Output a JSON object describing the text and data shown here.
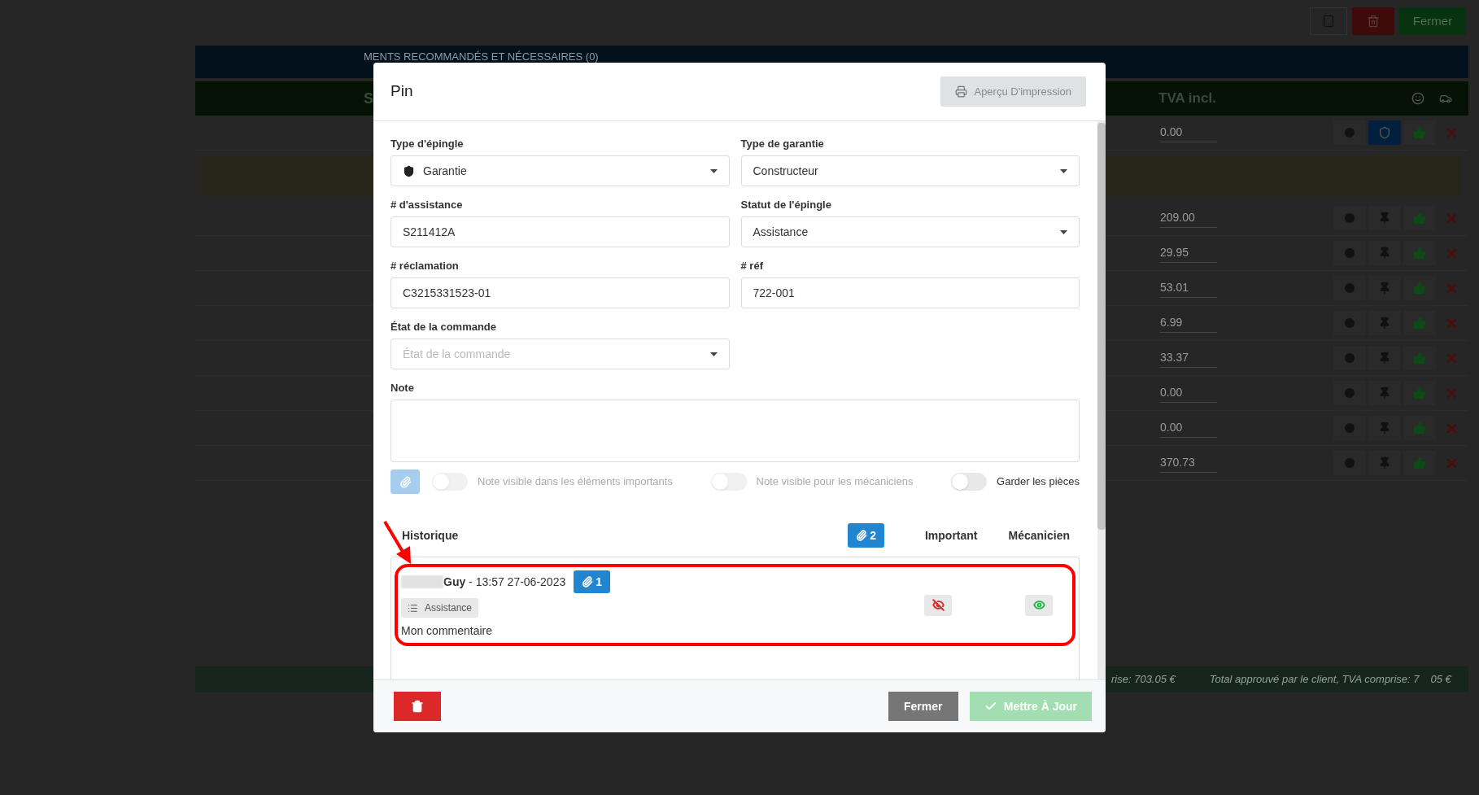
{
  "topbar": {
    "close_button": "Fermer"
  },
  "background": {
    "banner": "MENTS RECOMMANDÉS ET NÉCESSAIRES (0)",
    "header_letter": "S",
    "column_header": "TVA incl.",
    "rows": [
      {
        "amount": "0.00",
        "kind": "shield"
      },
      {
        "amount": "209.00",
        "kind": "pin"
      },
      {
        "amount": "29.95",
        "kind": "pin"
      },
      {
        "amount": "53.01",
        "kind": "pin"
      },
      {
        "amount": "6.99",
        "kind": "pin"
      },
      {
        "amount": "33.37",
        "kind": "pin"
      },
      {
        "amount": "0.00",
        "kind": "pin"
      },
      {
        "amount": "0.00",
        "kind": "pin"
      },
      {
        "amount": "370.73",
        "kind": "pin"
      }
    ],
    "totals": [
      "rise: 703.05 €",
      "Total approuvé par le client, TVA comprise: 7",
      "05 €"
    ]
  },
  "modal": {
    "title": "Pin",
    "print_button": "Aperçu D'impression",
    "fields": [
      {
        "label": "Type d'épingle",
        "kind": "icon_select",
        "value": "Garantie"
      },
      {
        "label": "Type de garantie",
        "kind": "select",
        "value": "Constructeur"
      },
      {
        "label": "# d'assistance",
        "kind": "text",
        "value": "S211412A"
      },
      {
        "label": "Statut de l'épingle",
        "kind": "select",
        "value": "Assistance"
      },
      {
        "label": "# réclamation",
        "kind": "text",
        "value": "C3215331523-01"
      },
      {
        "label": "# réf",
        "kind": "text",
        "value": "722-001"
      },
      {
        "label": "État de la commande",
        "kind": "select",
        "placeholder": "État de la commande"
      }
    ],
    "note": {
      "label": "Note"
    },
    "attach_disabled": true,
    "toggles": [
      {
        "label": "Note visible dans les éléments importants",
        "on": false,
        "disabled": true
      },
      {
        "label": "Note visible pour les mécaniciens",
        "on": false,
        "disabled": true
      },
      {
        "label": "Garder les pièces",
        "on": false,
        "disabled": false
      }
    ],
    "history": {
      "title": "Historique",
      "attachments": "2",
      "columns": [
        "Important",
        "Mécanicien"
      ],
      "entries": [
        {
          "author": "Guy",
          "time": " - 13:57 27-06-2023",
          "attachments": "1",
          "tag": "Assistance",
          "comment": "Mon commentaire",
          "important": false,
          "mechanic": true,
          "highlighted": true
        }
      ]
    },
    "footer": {
      "close_button": "Fermer",
      "update_button": "Mettre À Jour",
      "update_disabled": true
    }
  }
}
